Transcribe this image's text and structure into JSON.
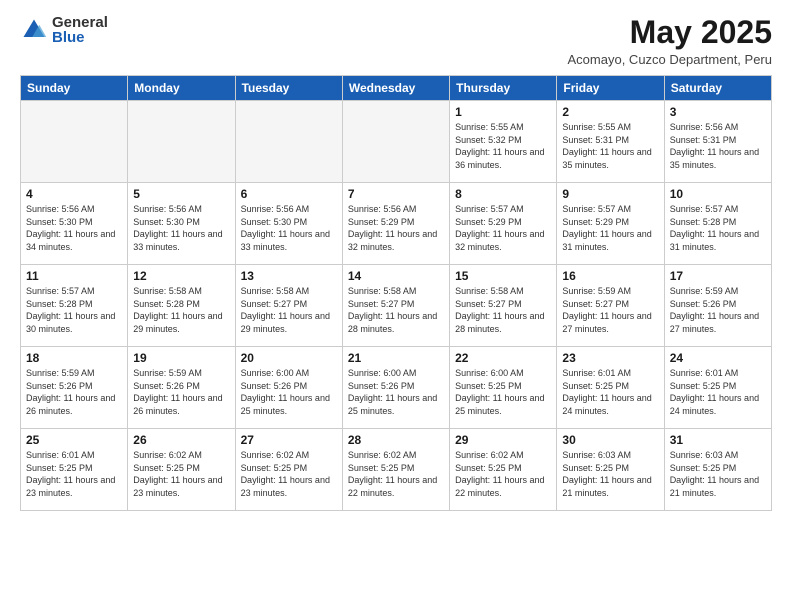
{
  "header": {
    "logo_general": "General",
    "logo_blue": "Blue",
    "month_title": "May 2025",
    "subtitle": "Acomayo, Cuzco Department, Peru"
  },
  "weekdays": [
    "Sunday",
    "Monday",
    "Tuesday",
    "Wednesday",
    "Thursday",
    "Friday",
    "Saturday"
  ],
  "weeks": [
    [
      {
        "day": "",
        "sunrise": "",
        "sunset": "",
        "daylight": "",
        "empty": true
      },
      {
        "day": "",
        "sunrise": "",
        "sunset": "",
        "daylight": "",
        "empty": true
      },
      {
        "day": "",
        "sunrise": "",
        "sunset": "",
        "daylight": "",
        "empty": true
      },
      {
        "day": "",
        "sunrise": "",
        "sunset": "",
        "daylight": "",
        "empty": true
      },
      {
        "day": "1",
        "sunrise": "Sunrise: 5:55 AM",
        "sunset": "Sunset: 5:32 PM",
        "daylight": "Daylight: 11 hours and 36 minutes.",
        "empty": false
      },
      {
        "day": "2",
        "sunrise": "Sunrise: 5:55 AM",
        "sunset": "Sunset: 5:31 PM",
        "daylight": "Daylight: 11 hours and 35 minutes.",
        "empty": false
      },
      {
        "day": "3",
        "sunrise": "Sunrise: 5:56 AM",
        "sunset": "Sunset: 5:31 PM",
        "daylight": "Daylight: 11 hours and 35 minutes.",
        "empty": false
      }
    ],
    [
      {
        "day": "4",
        "sunrise": "Sunrise: 5:56 AM",
        "sunset": "Sunset: 5:30 PM",
        "daylight": "Daylight: 11 hours and 34 minutes.",
        "empty": false
      },
      {
        "day": "5",
        "sunrise": "Sunrise: 5:56 AM",
        "sunset": "Sunset: 5:30 PM",
        "daylight": "Daylight: 11 hours and 33 minutes.",
        "empty": false
      },
      {
        "day": "6",
        "sunrise": "Sunrise: 5:56 AM",
        "sunset": "Sunset: 5:30 PM",
        "daylight": "Daylight: 11 hours and 33 minutes.",
        "empty": false
      },
      {
        "day": "7",
        "sunrise": "Sunrise: 5:56 AM",
        "sunset": "Sunset: 5:29 PM",
        "daylight": "Daylight: 11 hours and 32 minutes.",
        "empty": false
      },
      {
        "day": "8",
        "sunrise": "Sunrise: 5:57 AM",
        "sunset": "Sunset: 5:29 PM",
        "daylight": "Daylight: 11 hours and 32 minutes.",
        "empty": false
      },
      {
        "day": "9",
        "sunrise": "Sunrise: 5:57 AM",
        "sunset": "Sunset: 5:29 PM",
        "daylight": "Daylight: 11 hours and 31 minutes.",
        "empty": false
      },
      {
        "day": "10",
        "sunrise": "Sunrise: 5:57 AM",
        "sunset": "Sunset: 5:28 PM",
        "daylight": "Daylight: 11 hours and 31 minutes.",
        "empty": false
      }
    ],
    [
      {
        "day": "11",
        "sunrise": "Sunrise: 5:57 AM",
        "sunset": "Sunset: 5:28 PM",
        "daylight": "Daylight: 11 hours and 30 minutes.",
        "empty": false
      },
      {
        "day": "12",
        "sunrise": "Sunrise: 5:58 AM",
        "sunset": "Sunset: 5:28 PM",
        "daylight": "Daylight: 11 hours and 29 minutes.",
        "empty": false
      },
      {
        "day": "13",
        "sunrise": "Sunrise: 5:58 AM",
        "sunset": "Sunset: 5:27 PM",
        "daylight": "Daylight: 11 hours and 29 minutes.",
        "empty": false
      },
      {
        "day": "14",
        "sunrise": "Sunrise: 5:58 AM",
        "sunset": "Sunset: 5:27 PM",
        "daylight": "Daylight: 11 hours and 28 minutes.",
        "empty": false
      },
      {
        "day": "15",
        "sunrise": "Sunrise: 5:58 AM",
        "sunset": "Sunset: 5:27 PM",
        "daylight": "Daylight: 11 hours and 28 minutes.",
        "empty": false
      },
      {
        "day": "16",
        "sunrise": "Sunrise: 5:59 AM",
        "sunset": "Sunset: 5:27 PM",
        "daylight": "Daylight: 11 hours and 27 minutes.",
        "empty": false
      },
      {
        "day": "17",
        "sunrise": "Sunrise: 5:59 AM",
        "sunset": "Sunset: 5:26 PM",
        "daylight": "Daylight: 11 hours and 27 minutes.",
        "empty": false
      }
    ],
    [
      {
        "day": "18",
        "sunrise": "Sunrise: 5:59 AM",
        "sunset": "Sunset: 5:26 PM",
        "daylight": "Daylight: 11 hours and 26 minutes.",
        "empty": false
      },
      {
        "day": "19",
        "sunrise": "Sunrise: 5:59 AM",
        "sunset": "Sunset: 5:26 PM",
        "daylight": "Daylight: 11 hours and 26 minutes.",
        "empty": false
      },
      {
        "day": "20",
        "sunrise": "Sunrise: 6:00 AM",
        "sunset": "Sunset: 5:26 PM",
        "daylight": "Daylight: 11 hours and 25 minutes.",
        "empty": false
      },
      {
        "day": "21",
        "sunrise": "Sunrise: 6:00 AM",
        "sunset": "Sunset: 5:26 PM",
        "daylight": "Daylight: 11 hours and 25 minutes.",
        "empty": false
      },
      {
        "day": "22",
        "sunrise": "Sunrise: 6:00 AM",
        "sunset": "Sunset: 5:25 PM",
        "daylight": "Daylight: 11 hours and 25 minutes.",
        "empty": false
      },
      {
        "day": "23",
        "sunrise": "Sunrise: 6:01 AM",
        "sunset": "Sunset: 5:25 PM",
        "daylight": "Daylight: 11 hours and 24 minutes.",
        "empty": false
      },
      {
        "day": "24",
        "sunrise": "Sunrise: 6:01 AM",
        "sunset": "Sunset: 5:25 PM",
        "daylight": "Daylight: 11 hours and 24 minutes.",
        "empty": false
      }
    ],
    [
      {
        "day": "25",
        "sunrise": "Sunrise: 6:01 AM",
        "sunset": "Sunset: 5:25 PM",
        "daylight": "Daylight: 11 hours and 23 minutes.",
        "empty": false
      },
      {
        "day": "26",
        "sunrise": "Sunrise: 6:02 AM",
        "sunset": "Sunset: 5:25 PM",
        "daylight": "Daylight: 11 hours and 23 minutes.",
        "empty": false
      },
      {
        "day": "27",
        "sunrise": "Sunrise: 6:02 AM",
        "sunset": "Sunset: 5:25 PM",
        "daylight": "Daylight: 11 hours and 23 minutes.",
        "empty": false
      },
      {
        "day": "28",
        "sunrise": "Sunrise: 6:02 AM",
        "sunset": "Sunset: 5:25 PM",
        "daylight": "Daylight: 11 hours and 22 minutes.",
        "empty": false
      },
      {
        "day": "29",
        "sunrise": "Sunrise: 6:02 AM",
        "sunset": "Sunset: 5:25 PM",
        "daylight": "Daylight: 11 hours and 22 minutes.",
        "empty": false
      },
      {
        "day": "30",
        "sunrise": "Sunrise: 6:03 AM",
        "sunset": "Sunset: 5:25 PM",
        "daylight": "Daylight: 11 hours and 21 minutes.",
        "empty": false
      },
      {
        "day": "31",
        "sunrise": "Sunrise: 6:03 AM",
        "sunset": "Sunset: 5:25 PM",
        "daylight": "Daylight: 11 hours and 21 minutes.",
        "empty": false
      }
    ]
  ]
}
